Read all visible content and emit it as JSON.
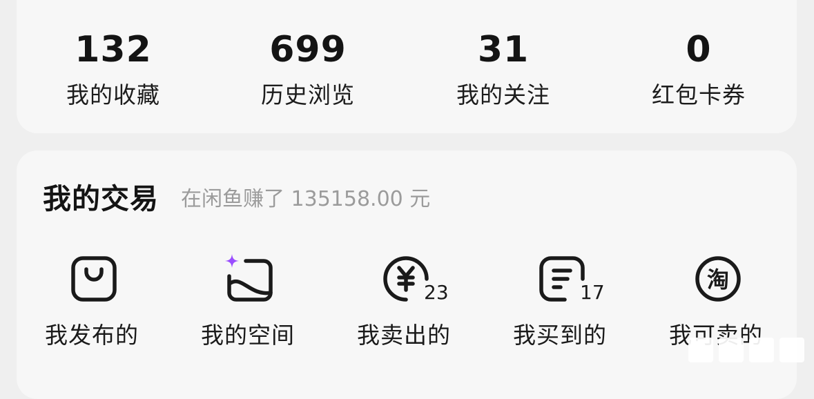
{
  "stats": [
    {
      "value": "132",
      "label": "我的收藏"
    },
    {
      "value": "699",
      "label": "历史浏览"
    },
    {
      "value": "31",
      "label": "我的关注"
    },
    {
      "value": "0",
      "label": "红包卡券"
    }
  ],
  "trade": {
    "title": "我的交易",
    "subtitle": "在闲鱼赚了 135158.00 元",
    "actions": [
      {
        "label": "我发布的",
        "icon": "shopping-bag-icon"
      },
      {
        "label": "我的空间",
        "icon": "sparkle-image-icon"
      },
      {
        "label": "我卖出的",
        "icon": "yen-circle-icon",
        "badge": "23"
      },
      {
        "label": "我买到的",
        "icon": "order-list-icon",
        "badge": "17"
      },
      {
        "label": "我可卖的",
        "icon": "taobao-icon",
        "icon_text": "淘"
      }
    ]
  },
  "colors": {
    "background": "#efefef",
    "card": "#f7f7f7",
    "text": "#141414",
    "subtitle": "#9b9b9b",
    "sparkle": "#9a4dff"
  }
}
